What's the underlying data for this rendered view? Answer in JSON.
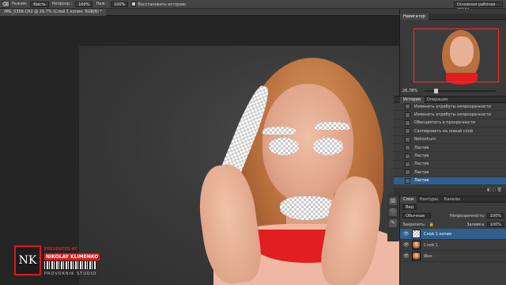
{
  "options_bar": {
    "tool_icon": "eraser-icon",
    "mode_label": "Режим:",
    "mode_value": "Кисть",
    "opacity_label": "Непрозр.:",
    "opacity_value": "100%",
    "flow_label": "Наж.:",
    "flow_value": "100%",
    "restore_label": "Восстановить историю",
    "workspace": "Основная рабочая среда"
  },
  "document_tab": {
    "title": "IMG_0356.CR2 @ 26,7% (Слой 1 копия, RGB/8) *"
  },
  "navigator": {
    "title": "Навигатор",
    "zoom": "26,78%"
  },
  "history": {
    "tabs": [
      "История",
      "Операции"
    ],
    "items": [
      {
        "label": "Изменить атрибуты непрозрачности",
        "active": false
      },
      {
        "label": "Изменить атрибуты непрозрачности",
        "active": false
      },
      {
        "label": "Обесцветить в прозрачности",
        "active": false
      },
      {
        "label": "Скопировать на новый слой",
        "active": false
      },
      {
        "label": "Retrozhurn",
        "active": false
      },
      {
        "label": "Ластик",
        "active": false
      },
      {
        "label": "Ластик",
        "active": false
      },
      {
        "label": "Ластик",
        "active": false
      },
      {
        "label": "Ластик",
        "active": false
      },
      {
        "label": "Ластик",
        "active": true
      }
    ]
  },
  "layers": {
    "tabs": [
      "Слои",
      "Контуры",
      "Каналы"
    ],
    "filter_label": "Вид",
    "blend_mode": "Обычные",
    "opacity_label": "Непрозрачность:",
    "opacity_value": "100%",
    "lock_label": "Закрепить:",
    "fill_label": "Заливка:",
    "fill_value": "100%",
    "items": [
      {
        "name": "Слой 1 копия",
        "thumb": "check",
        "active": true
      },
      {
        "name": "Слой 1",
        "thumb": "photo",
        "active": false
      },
      {
        "name": "Фон",
        "thumb": "photo",
        "active": false
      }
    ]
  },
  "logo": {
    "tagline": "PRESENTED BY",
    "name": "NIKOLAY KLIMENKO",
    "studio": "PROVOKNIK STUDIO",
    "monogram": "NK"
  },
  "colors": {
    "accent_red": "#e01818",
    "selection_blue": "#2d5f8f"
  }
}
